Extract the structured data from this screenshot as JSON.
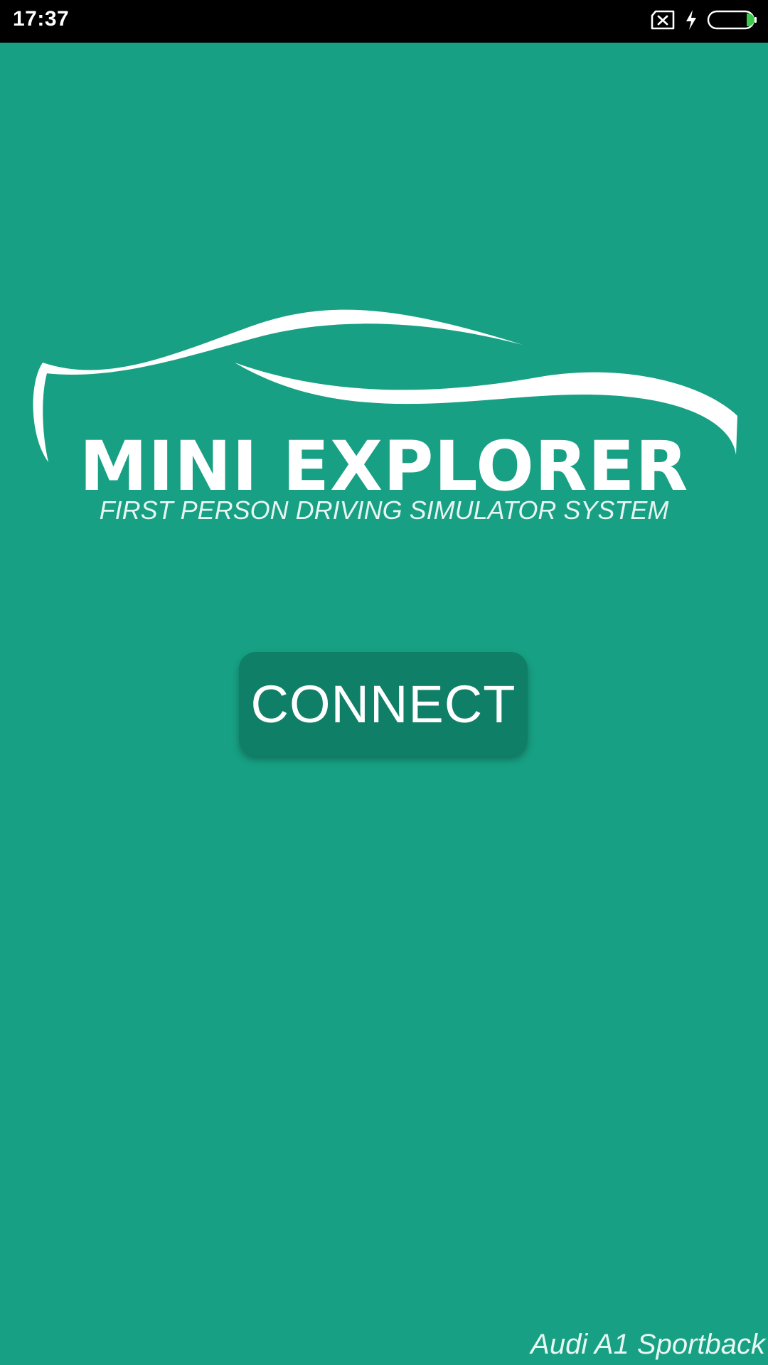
{
  "status_bar": {
    "time": "17:37",
    "icons": [
      "sim-error-icon",
      "charging-bolt-icon",
      "battery-icon"
    ],
    "battery_level": 0.1
  },
  "app": {
    "background_color": "#17a083",
    "logo": {
      "title": "MINI EXPLORER",
      "subtitle": "FIRST PERSON DRIVING SIMULATOR SYSTEM"
    },
    "connect_button": {
      "label": "CONNECT",
      "color": "#107f67"
    },
    "footer_label": "Audi A1 Sportback"
  }
}
